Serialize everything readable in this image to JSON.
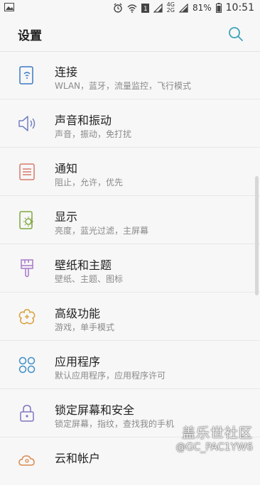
{
  "status_bar": {
    "signal_net_top": "4G",
    "signal_net_bottom": "2G",
    "battery_percent": "81%",
    "time": "10:51"
  },
  "header": {
    "title": "设置"
  },
  "settings": [
    {
      "title": "连接",
      "subtitle": "WLAN，蓝牙，流量监控，飞行模式",
      "icon": "connection-icon",
      "color": "#3a7ac3"
    },
    {
      "title": "声音和振动",
      "subtitle": "声音，振动，免打扰",
      "icon": "speaker-icon",
      "color": "#7280c4"
    },
    {
      "title": "通知",
      "subtitle": "阻止，允许，优先",
      "icon": "notification-icon",
      "color": "#d77a6c"
    },
    {
      "title": "显示",
      "subtitle": "亮度，蓝光过滤，主屏幕",
      "icon": "display-icon",
      "color": "#7fa83f"
    },
    {
      "title": "壁纸和主题",
      "subtitle": "壁纸、主题、图标",
      "icon": "brush-icon",
      "color": "#a779c8"
    },
    {
      "title": "高级功能",
      "subtitle": "游戏，单手模式",
      "icon": "advanced-icon",
      "color": "#d9a23c"
    },
    {
      "title": "应用程序",
      "subtitle": "默认应用程序，应用程序许可",
      "icon": "apps-icon",
      "color": "#3d8fc6"
    },
    {
      "title": "锁定屏幕和安全",
      "subtitle": "锁定屏幕，指纹，查找我的手机",
      "icon": "lock-icon",
      "color": "#7e76c3"
    },
    {
      "title": "云和帐户",
      "subtitle": "",
      "icon": "cloud-account-icon",
      "color": "#d98a4e"
    }
  ],
  "watermark": {
    "line1": "盖乐世社区",
    "line2": "@GC_PAC1YW6"
  }
}
